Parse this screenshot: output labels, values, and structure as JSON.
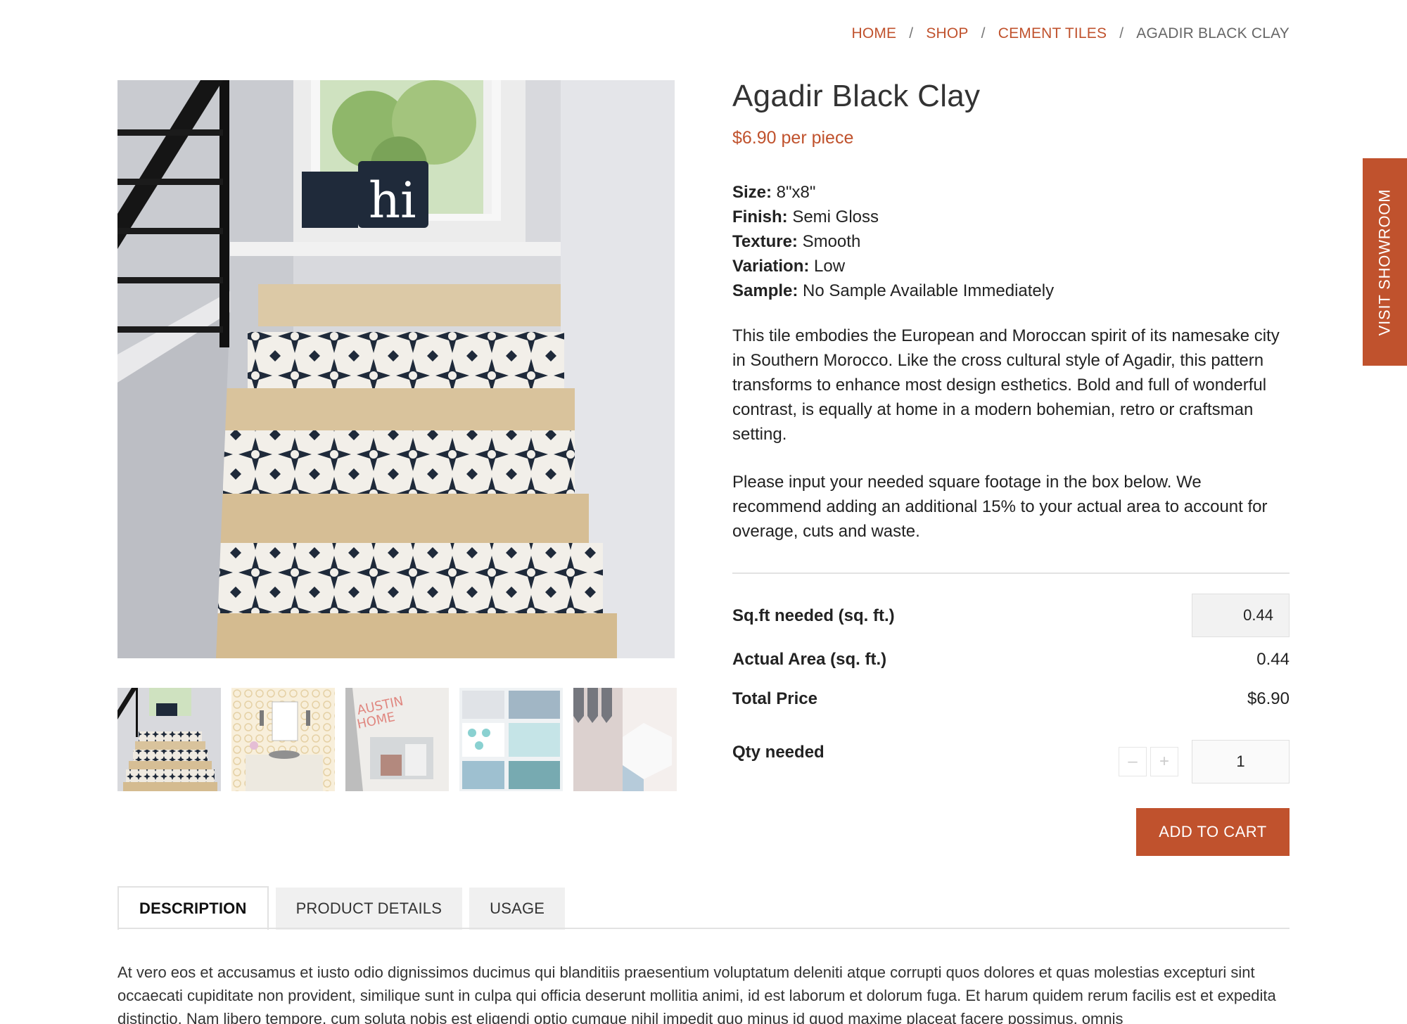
{
  "breadcrumb": {
    "items": [
      "HOME",
      "SHOP",
      "CEMENT TILES"
    ],
    "current": "AGADIR BLACK CLAY",
    "separator": "/"
  },
  "product": {
    "title": "Agadir Black Clay",
    "price": "$6.90 per piece",
    "specs": [
      {
        "label": "Size:",
        "value": " 8\"x8\""
      },
      {
        "label": "Finish:",
        "value": " Semi Gloss"
      },
      {
        "label": "Texture:",
        "value": " Smooth"
      },
      {
        "label": "Variation:",
        "value": " Low"
      },
      {
        "label": "Sample:",
        "value": " No Sample Available Immediately"
      }
    ],
    "description": "This tile embodies the European and Moroccan spirit of its namesake city in Southern Morocco. Like the cross cultural style of Agadir, this pattern transforms to enhance most design esthetics. Bold and full of wonderful contrast, is equally at home in a modern bohemian, retro or craftsman setting.",
    "instructions": "Please input your needed square footage in the box below. We recommend adding an additional 15% to your actual area to account for overage, cuts and waste."
  },
  "calculator": {
    "sqft_label": "Sq.ft needed (sq. ft.)",
    "sqft_value": "0.44",
    "area_label": "Actual Area (sq. ft.)",
    "area_value": "0.44",
    "total_label": "Total Price",
    "total_value": "$6.90",
    "qty_label": "Qty needed",
    "qty_value": "1",
    "minus": "–",
    "plus": "+"
  },
  "add_to_cart": "ADD TO CART",
  "tabs": [
    "DESCRIPTION",
    "PRODUCT DETAILS",
    "USAGE"
  ],
  "tab_body": "At vero eos et accusamus et iusto odio dignissimos ducimus qui blanditiis praesentium voluptatum deleniti atque corrupti quos dolores et quas molestias excepturi sint occaecati cupiditate non provident, similique sunt in culpa qui officia deserunt mollitia animi, id est laborum et dolorum fuga. Et harum quidem rerum facilis est et expedita distinctio. Nam libero tempore, cum soluta nobis est eligendi optio cumque nihil impedit quo minus id quod maxime placeat facere possimus, omnis",
  "showroom": "VISIT SHOWROOM",
  "colors": {
    "accent": "#c0522d",
    "text": "#222222",
    "divider": "#e2e2e2"
  }
}
